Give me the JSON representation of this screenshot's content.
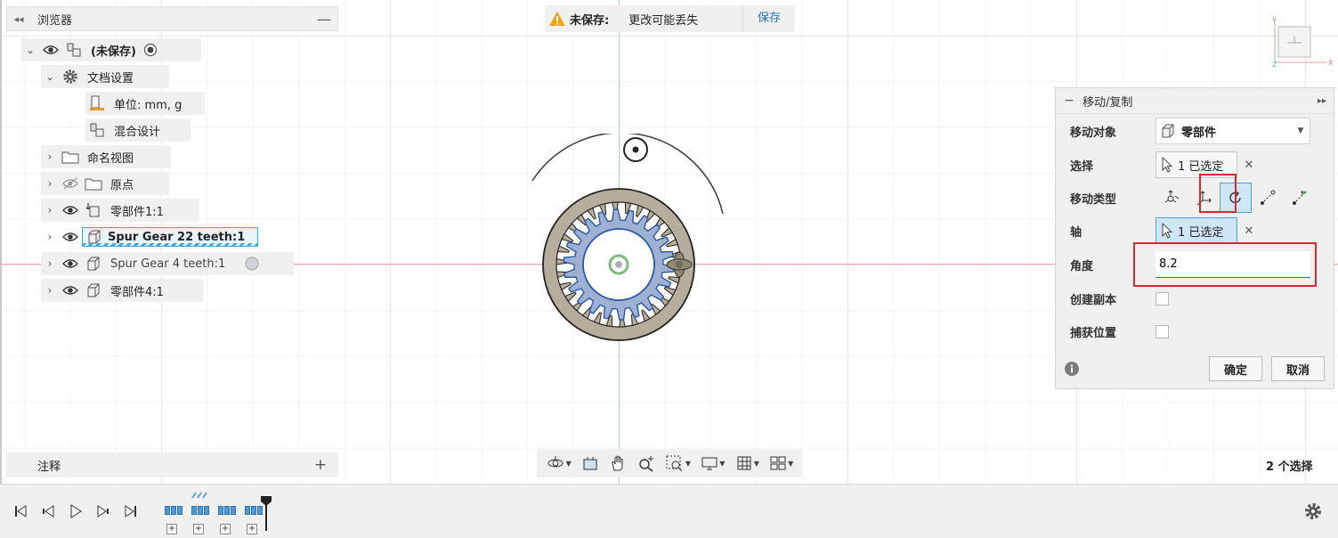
{
  "browser": {
    "title": "浏览器",
    "items": [
      {
        "label": "(未保存)",
        "icon": "component-icon"
      },
      {
        "label": "文档设置",
        "icon": "gear-icon"
      },
      {
        "label": "单位: mm, g",
        "icon": "units-icon"
      },
      {
        "label": "混合设计",
        "icon": "hybrid-design-icon"
      },
      {
        "label": "命名视图",
        "icon": "folder-icon"
      },
      {
        "label": "原点",
        "icon": "folder-icon"
      },
      {
        "label": "零部件1:1",
        "icon": "anchored-component-icon"
      },
      {
        "label": "Spur Gear 22 teeth:1",
        "icon": "component-icon"
      },
      {
        "label": "Spur Gear 4 teeth:1",
        "icon": "component-icon"
      },
      {
        "label": "零部件4:1",
        "icon": "component-icon"
      }
    ]
  },
  "notes": {
    "title": "注释"
  },
  "unsaved": {
    "label": "未保存:",
    "message": "更改可能丢失",
    "save": "保存"
  },
  "dialog": {
    "title": "移动/复制",
    "move_object_label": "移动对象",
    "move_object_value": "零部件",
    "selection_label": "选择",
    "selection_value": "1 已选定",
    "move_type_label": "移动类型",
    "move_types": [
      "free-move-icon",
      "translate-icon",
      "rotate-icon",
      "point-to-point-icon",
      "point-to-position-icon"
    ],
    "active_move_type": "rotate-icon",
    "axis_label": "轴",
    "axis_value": "1 已选定",
    "angle_label": "角度",
    "angle_value": "8.2",
    "create_copy_label": "创建副本",
    "capture_position_label": "捕获位置",
    "ok": "确定",
    "cancel": "取消"
  },
  "status": {
    "selection_count": "2 个选择"
  },
  "colors": {
    "accent": "#1f73b7",
    "highlight_red": "#d42a2a",
    "x_axis": "#f1a7a7",
    "y_axis": "#9fe09f"
  }
}
